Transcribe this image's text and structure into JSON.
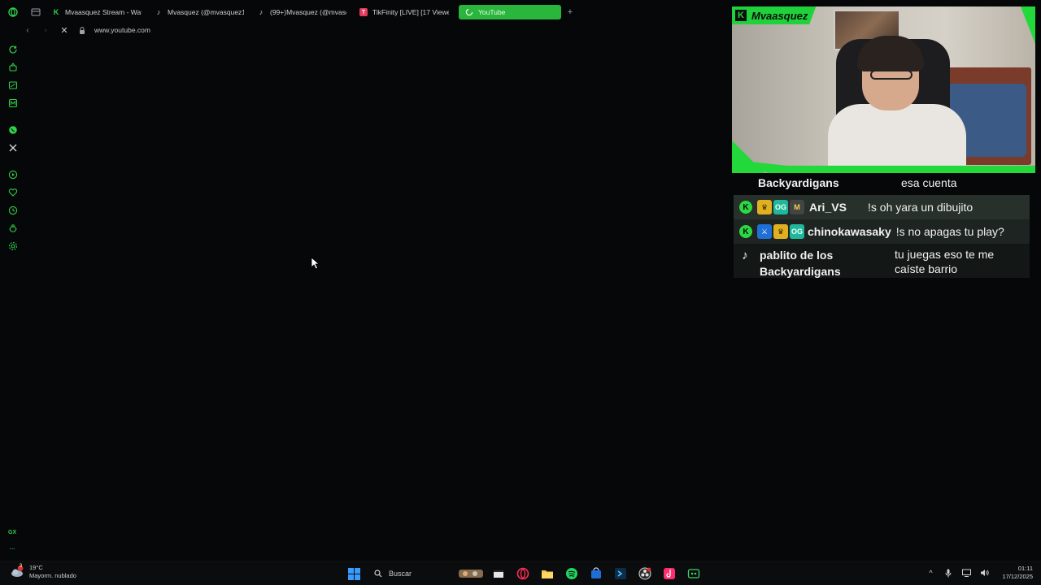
{
  "tabs": [
    {
      "label": "Mvaasquez Stream - Watc",
      "icon": "kick-icon",
      "color": "#2fd04a"
    },
    {
      "label": "Mvasquez (@mvasquez12",
      "icon": "tiktok-icon",
      "color": "#ffffff"
    },
    {
      "label": "(99+)Mvasquez (@mvaso",
      "icon": "tiktok-icon",
      "color": "#ffffff"
    },
    {
      "label": "TikFinity [LIVE] [17 Viewe",
      "icon": "tikfinity-icon",
      "color": "#e23b5a"
    },
    {
      "label": "YouTube",
      "icon": "loading-icon",
      "color": "#e9ffe9"
    }
  ],
  "address": {
    "url": "www.youtube.com"
  },
  "overlay": {
    "streamer_name": "Mvaasquez",
    "accent_color": "#1fd13a"
  },
  "chat": [
    {
      "platform": "tiktok",
      "user": "Backyardigans",
      "text": "esa cuenta",
      "badges": []
    },
    {
      "platform": "kick",
      "user": "Ari_VS",
      "text": "!s oh yara un dibujito",
      "badges": [
        "crown",
        "og",
        "m"
      ]
    },
    {
      "platform": "kick",
      "user": "chinokawasaky",
      "text": "!s no apagas tu play?",
      "badges": [
        "sword",
        "crown",
        "og"
      ]
    },
    {
      "platform": "tiktok",
      "user": "pablito de los Backyardigans",
      "text": "tu juegas eso te me caíste barrio",
      "badges": []
    }
  ],
  "taskbar": {
    "weather_temp": "19°C",
    "weather_desc": "Mayorm. nublado",
    "weather_badge": "3",
    "search_placeholder": "Buscar",
    "time": "01:11",
    "date": "17/12/2025"
  }
}
